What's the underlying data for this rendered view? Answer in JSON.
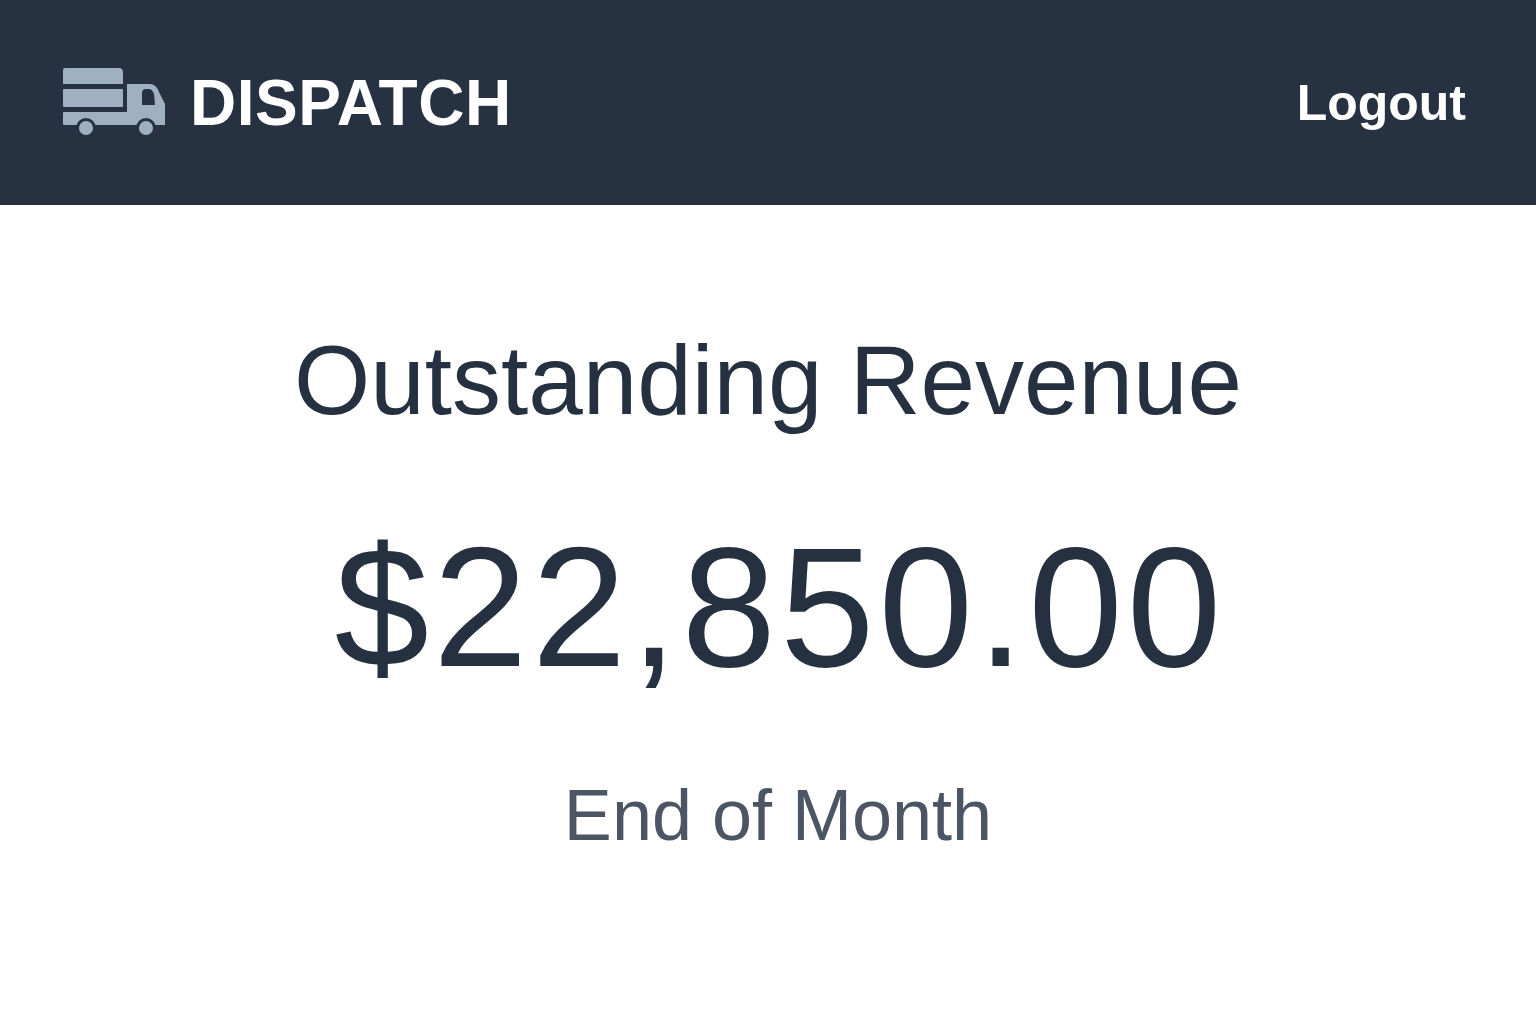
{
  "header": {
    "brand": "DISPATCH",
    "logout": "Logout"
  },
  "summary": {
    "title": "Outstanding Revenue",
    "amount": "$22,850.00",
    "period": "End of Month"
  }
}
